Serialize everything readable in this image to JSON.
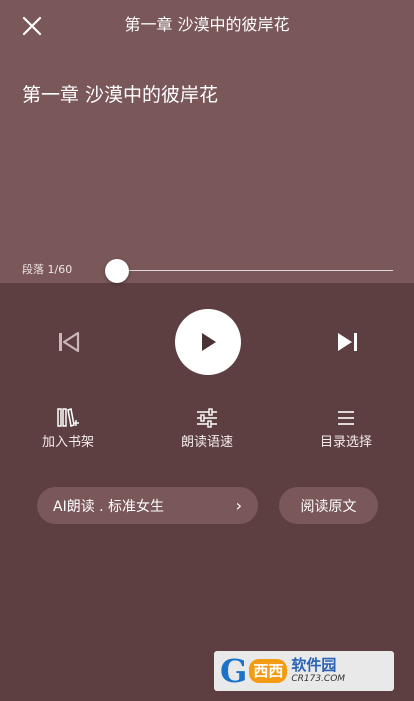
{
  "header": {
    "title": "第一章 沙漠中的彼岸花",
    "close_icon": "close-icon"
  },
  "content": {
    "chapter_title": "第一章 沙漠中的彼岸花"
  },
  "progress": {
    "label": "段落 1/60",
    "current": 1,
    "total": 60
  },
  "controls": {
    "prev_icon": "skip-previous-icon",
    "play_icon": "play-icon",
    "next_icon": "skip-next-icon"
  },
  "actions": [
    {
      "label": "加入书架",
      "icon": "add-to-shelf-icon"
    },
    {
      "label": "朗读语速",
      "icon": "speed-adjust-icon"
    },
    {
      "label": "目录选择",
      "icon": "menu-list-icon"
    }
  ],
  "voice": {
    "label": "AI朗读 . 标准女生",
    "chevron": "›"
  },
  "original": {
    "label": "阅读原文"
  },
  "watermark": {
    "g": "G",
    "badge": "西西",
    "main": "软件园",
    "sub": "CR173.COM"
  },
  "colors": {
    "top_background": "#7a5759",
    "bottom_background": "#5d3f41",
    "pill_background": "#7a5759",
    "text": "#ffffff"
  }
}
